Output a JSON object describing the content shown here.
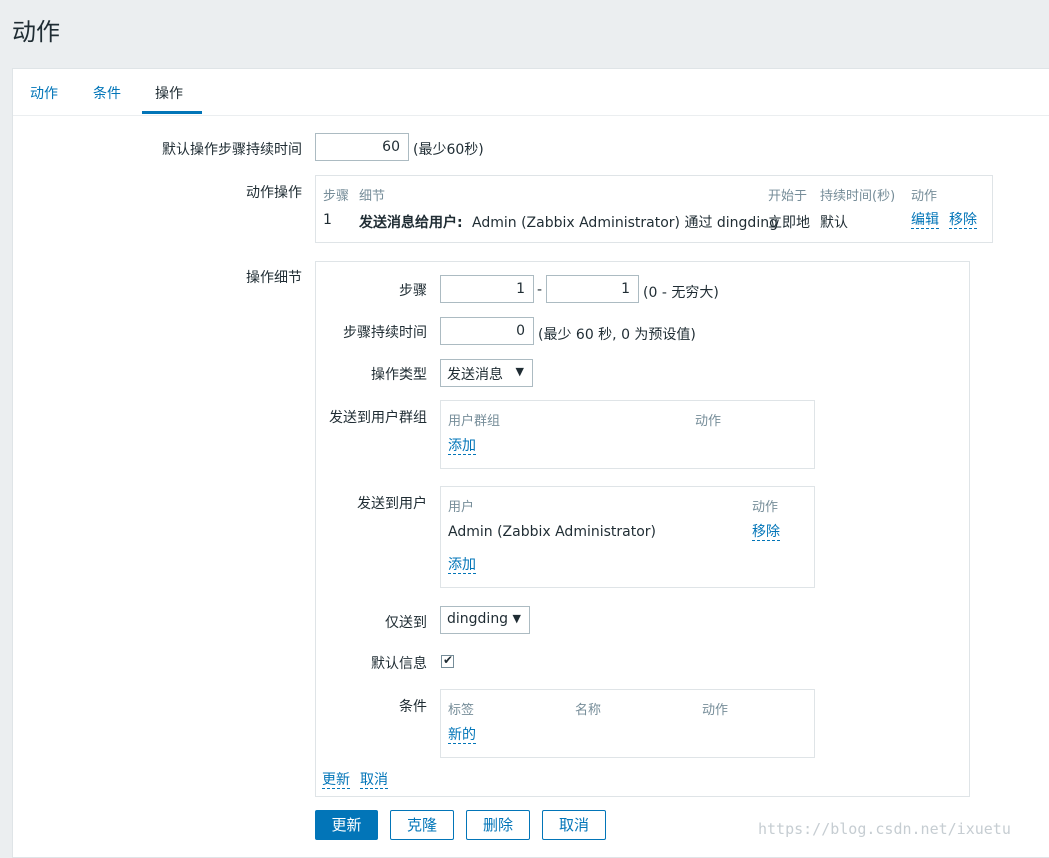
{
  "page": {
    "title": "动作"
  },
  "tabs": [
    {
      "label": "动作"
    },
    {
      "label": "条件"
    },
    {
      "label": "操作"
    }
  ],
  "form": {
    "default_duration": {
      "label": "默认操作步骤持续时间",
      "value": "60",
      "hint": "(最少60秒)"
    },
    "operations": {
      "label": "动作操作",
      "headers": {
        "step": "步骤",
        "detail": "细节",
        "start": "开始于",
        "duration": "持续时间(秒)",
        "action": "动作"
      },
      "rows": [
        {
          "step": "1",
          "detail_bold": "发送消息给用户:",
          "detail_text": "Admin (Zabbix Administrator) 通过 dingding",
          "start": "立即地",
          "duration": "默认",
          "edit": "编辑",
          "remove": "移除"
        }
      ]
    },
    "details": {
      "label": "操作细节",
      "steps": {
        "label": "步骤",
        "from": "1",
        "separator": "-",
        "to": "1",
        "hint": "(0 - 无穷大)"
      },
      "step_duration": {
        "label": "步骤持续时间",
        "value": "0",
        "hint": "(最少 60 秒, 0 为预设值)"
      },
      "op_type": {
        "label": "操作类型",
        "value": "发送消息"
      },
      "send_to_groups": {
        "label": "发送到用户群组",
        "headers": {
          "group": "用户群组",
          "action": "动作"
        },
        "add": "添加"
      },
      "send_to_users": {
        "label": "发送到用户",
        "headers": {
          "user": "用户",
          "action": "动作"
        },
        "rows": [
          {
            "user": "Admin (Zabbix Administrator)",
            "remove": "移除"
          }
        ],
        "add": "添加"
      },
      "send_only_to": {
        "label": "仅送到",
        "value": "dingding"
      },
      "default_message": {
        "label": "默认信息",
        "checked": true
      },
      "conditions": {
        "label": "条件",
        "headers": {
          "tag": "标签",
          "name": "名称",
          "action": "动作"
        },
        "new": "新的"
      },
      "update_link": "更新",
      "cancel_link": "取消"
    }
  },
  "buttons": {
    "update": "更新",
    "clone": "克隆",
    "delete": "删除",
    "cancel": "取消"
  },
  "watermark": "https://blog.csdn.net/ixuetu",
  "colors": {
    "accent": "#0275b8",
    "background": "#ebeef0",
    "text": "#1f2c33",
    "muted": "#768d99"
  }
}
